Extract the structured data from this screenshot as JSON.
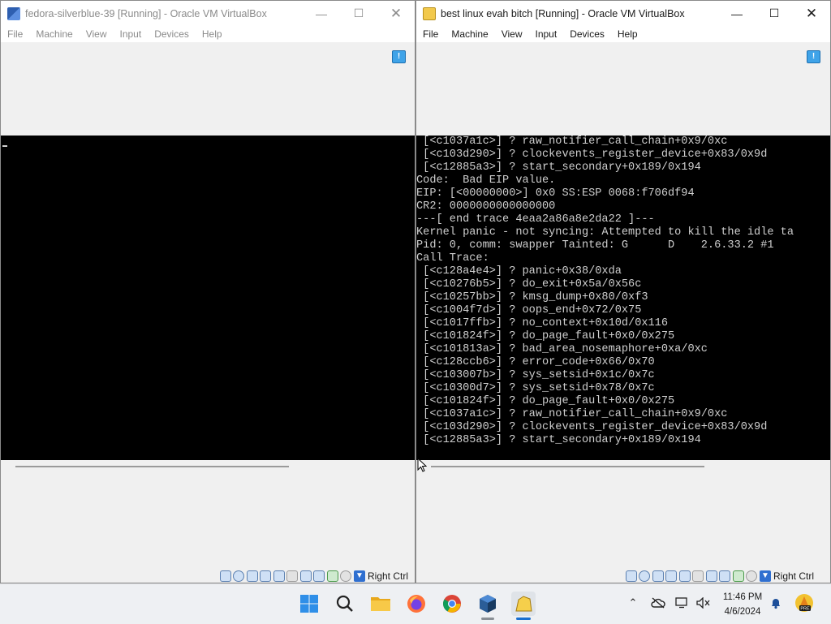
{
  "windows": [
    {
      "title": "fedora-silverblue-39 [Running] - Oracle VM VirtualBox",
      "menu": [
        "File",
        "Machine",
        "View",
        "Input",
        "Devices",
        "Help"
      ],
      "host_key": "Right Ctrl",
      "console_lines": []
    },
    {
      "title": "best linux evah bitch [Running] - Oracle VM VirtualBox",
      "menu": [
        "File",
        "Machine",
        "View",
        "Input",
        "Devices",
        "Help"
      ],
      "host_key": "Right Ctrl",
      "console_lines": [
        " [<c1037a1c>] ? raw_notifier_call_chain+0x9/0xc",
        " [<c103d290>] ? clockevents_register_device+0x83/0x9d",
        " [<c12885a3>] ? start_secondary+0x189/0x194",
        "Code:  Bad EIP value.",
        "EIP: [<00000000>] 0x0 SS:ESP 0068:f706df94",
        "CR2: 0000000000000000",
        "---[ end trace 4eaa2a86a8e2da22 ]---",
        "Kernel panic - not syncing: Attempted to kill the idle ta",
        "Pid: 0, comm: swapper Tainted: G      D    2.6.33.2 #1",
        "Call Trace:",
        " [<c128a4e4>] ? panic+0x38/0xda",
        " [<c10276b5>] ? do_exit+0x5a/0x56c",
        " [<c10257bb>] ? kmsg_dump+0x80/0xf3",
        " [<c1004f7d>] ? oops_end+0x72/0x75",
        " [<c1017ffb>] ? no_context+0x10d/0x116",
        " [<c101824f>] ? do_page_fault+0x0/0x275",
        " [<c101813a>] ? bad_area_nosemaphore+0xa/0xc",
        " [<c128ccb6>] ? error_code+0x66/0x70",
        " [<c103007b>] ? sys_setsid+0x1c/0x7c",
        " [<c10300d7>] ? sys_setsid+0x78/0x7c",
        " [<c101824f>] ? do_page_fault+0x0/0x275",
        " [<c1037a1c>] ? raw_notifier_call_chain+0x9/0xc",
        " [<c103d290>] ? clockevents_register_device+0x83/0x9d",
        " [<c12885a3>] ? start_secondary+0x189/0x194"
      ]
    }
  ],
  "taskbar": {
    "apps": [
      "windows-start",
      "search",
      "file-explorer",
      "firefox",
      "chrome",
      "virtualbox",
      "virtualbox-vm"
    ],
    "time": "11:46 PM",
    "date": "4/6/2024"
  },
  "colors": {
    "console_bg": "#000000",
    "console_fg": "#cfcfcf",
    "window_bg": "#f0f0f0",
    "taskbar_bg": "#eef0f3"
  }
}
